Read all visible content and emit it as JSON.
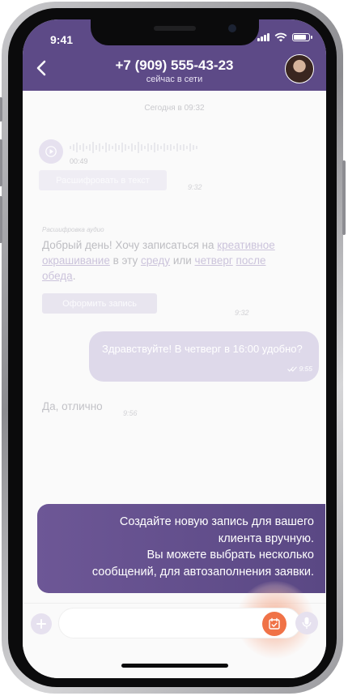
{
  "status_bar": {
    "time": "9:41"
  },
  "header": {
    "contact_phone": "+7 (909) 555-43-23",
    "contact_status": "сейчас в сети",
    "accent_color": "#5d4a87"
  },
  "chat": {
    "date_separator": "Сегодня в 09:32",
    "audio_message": {
      "duration": "00:49"
    },
    "transcribe_button": "Расшифровать в текст",
    "audio_time": "9:32",
    "transcript_label": "Расшифровка аудио",
    "transcript": {
      "part1": "Добрый день! Хочу записаться на ",
      "link1": "креативное окрашивание",
      "part2": " в эту ",
      "link2": "среду",
      "part3": " или ",
      "link3": "четверг",
      "part4": " ",
      "link4": "после обеда",
      "part5": "."
    },
    "book_button": "Оформить запись",
    "transcript_time": "9:32",
    "outgoing_message": {
      "text": "Здравствуйте! В четверг в 16:00 удобно?",
      "time": "9:55"
    },
    "incoming_message": {
      "text": "Да, отлично",
      "time": "9:56"
    }
  },
  "tooltip": {
    "line1": "Создайте новую запись  для вашего",
    "line2": "клиента вручную.",
    "line3": "Вы можете выбрать несколько",
    "line4": "сообщений, для автозаполнения  заявки.",
    "color": "#6d5796"
  },
  "composer": {
    "input_value": "",
    "highlight_color": "#f07247"
  }
}
